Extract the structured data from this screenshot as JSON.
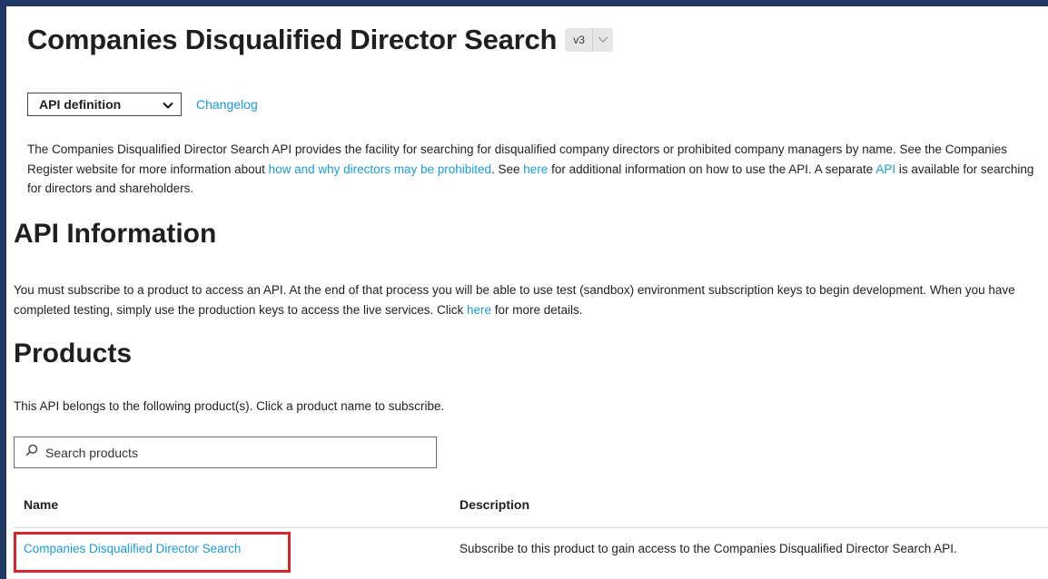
{
  "header": {
    "title": "Companies Disqualified Director Search",
    "version": "v3"
  },
  "toolbar": {
    "select_value": "API definition",
    "changelog_label": "Changelog"
  },
  "description": {
    "part1": "The Companies Disqualified Director Search API provides the facility for searching for disqualified company directors or prohibited company managers by name. See the Companies Register website for more information about ",
    "link1": "how and why directors may be prohibited",
    "part2": ". See ",
    "link2": "here",
    "part3": " for additional information on how to use the API. A separate ",
    "link3": "API",
    "part4": " is available for searching for directors and shareholders."
  },
  "api_info": {
    "heading": "API Information",
    "text1": "You must subscribe to a product to access an API. At the end of that process you will be able to use test (sandbox) environment subscription keys to begin development. When you have completed testing, simply use the production keys to access the live services. Click ",
    "link": "here",
    "text2": " for more details."
  },
  "products": {
    "heading": "Products",
    "intro": "This API belongs to the following product(s). Click a product name to subscribe.",
    "search_placeholder": "Search products",
    "columns": {
      "name": "Name",
      "description": "Description"
    },
    "rows": [
      {
        "name": "Companies Disqualified Director Search",
        "description": "Subscribe to this product to gain access to the Companies Disqualified Director Search API."
      }
    ]
  },
  "colors": {
    "link": "#1a9bd7",
    "frame": "#1f3864",
    "highlight": "#d9262c"
  }
}
